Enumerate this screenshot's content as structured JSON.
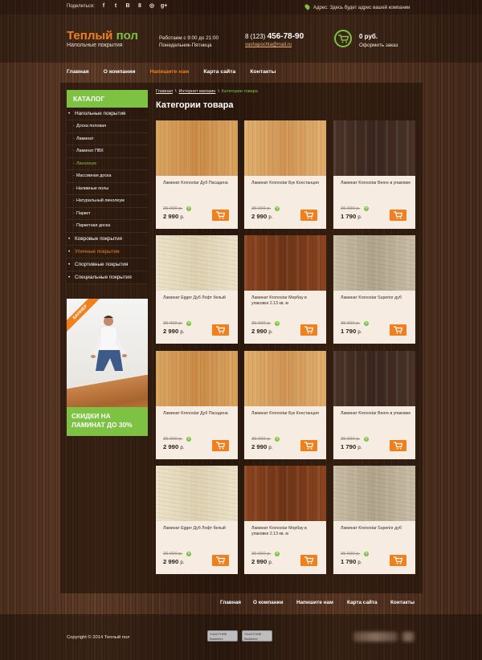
{
  "topbar": {
    "share_label": "Поделиться:",
    "social_icons": [
      "facebook-icon",
      "twitter-icon",
      "vkontakte-icon",
      "odnoklassniki-icon",
      "mailru-icon",
      "googleplus-icon"
    ],
    "social_glyphs": [
      "f",
      "t",
      "B",
      "8",
      "◎",
      "g+"
    ],
    "address": "Адрес: Здесь будет адрес вашей компании"
  },
  "header": {
    "logo_word1": "Теплый",
    "logo_word2": "пол",
    "tagline": "Напольные покрытия",
    "hours_line1": "Работаем с 9:00 до 21:00",
    "hours_line2": "Понедельник-Пятница",
    "phone_code": "8 (123)",
    "phone_number": "456-78-90",
    "email": "vashapochta@mail.ru",
    "cart_sum": "0 руб.",
    "cart_link": "Оформить заказ"
  },
  "nav": {
    "items": [
      {
        "label": "Главная",
        "active": false
      },
      {
        "label": "О компании",
        "active": false
      },
      {
        "label": "Напишите нам",
        "active": true
      },
      {
        "label": "Карта сайта",
        "active": false
      },
      {
        "label": "Контакты",
        "active": false
      }
    ]
  },
  "sidebar": {
    "title": "КАТАЛОГ",
    "items": [
      {
        "label": "Напольные покрытия",
        "level": "top",
        "state": ""
      },
      {
        "label": "Доска половая",
        "level": "sub",
        "state": ""
      },
      {
        "label": "Ламинат",
        "level": "sub",
        "state": ""
      },
      {
        "label": "Ламинат ПВХ",
        "level": "sub",
        "state": ""
      },
      {
        "label": "Линолеум",
        "level": "sub",
        "state": "green"
      },
      {
        "label": "Массивная доска",
        "level": "sub",
        "state": ""
      },
      {
        "label": "Наливные полы",
        "level": "sub",
        "state": ""
      },
      {
        "label": "Натуральный линолеум",
        "level": "sub",
        "state": ""
      },
      {
        "label": "Паркет",
        "level": "sub",
        "state": ""
      },
      {
        "label": "Паркетная доска",
        "level": "sub",
        "state": ""
      },
      {
        "label": "Ковровые покрытия",
        "level": "top",
        "state": ""
      },
      {
        "label": "Уличные покрытия",
        "level": "top",
        "state": "orange"
      },
      {
        "label": "Спортивные покрытия",
        "level": "top",
        "state": ""
      },
      {
        "label": "Специальные покрытия",
        "level": "top",
        "state": ""
      }
    ],
    "banner_ribbon": "БАННЕР",
    "banner_line1": "СКИДКИ НА",
    "banner_line2": "ЛАМИНАТ ДО 30%"
  },
  "breadcrumb": {
    "items": [
      "Главная",
      "Интернет магазин",
      "Категории товара"
    ],
    "separator": "\\"
  },
  "page_title": "Категории товара",
  "products": [
    {
      "name": "Ламинат Kronostar Дуб Пасадена",
      "old_price": "35 990 р.",
      "price": "2 990",
      "unit": "р.",
      "wood": "oak"
    },
    {
      "name": "Ламинат Kronostar Бук Констанция",
      "old_price": "35 990 р.",
      "price": "2 990",
      "unit": "р.",
      "wood": "beech"
    },
    {
      "name": "Ламинат Kronostar Венге в упаковке",
      "old_price": "35 990 р.",
      "price": "1 790",
      "unit": "р.",
      "wood": "wenge"
    },
    {
      "name": "Ламинат Egger Дуб Лофт белый",
      "old_price": "35 990 р.",
      "price": "2 990",
      "unit": "р.",
      "wood": "white"
    },
    {
      "name": "Ламинат Kronostar Мербау в упаковке 2.13 кв. м",
      "old_price": "35 990 р.",
      "price": "2 990",
      "unit": "р.",
      "wood": "merbau"
    },
    {
      "name": "Ламинат Kronostar Superior дуб",
      "old_price": "35 990 р.",
      "price": "1 790",
      "unit": "р.",
      "wood": "grey"
    },
    {
      "name": "Ламинат Kronostar Дуб Пасадена",
      "old_price": "35 990 р.",
      "price": "2 990",
      "unit": "р.",
      "wood": "oak"
    },
    {
      "name": "Ламинат Kronostar Бук Констанция",
      "old_price": "35 990 р.",
      "price": "2 990",
      "unit": "р.",
      "wood": "beech"
    },
    {
      "name": "Ламинат Kronostar Венге в упаковке",
      "old_price": "35 990 р.",
      "price": "1 790",
      "unit": "р.",
      "wood": "wenge"
    },
    {
      "name": "Ламинат Egger Дуб Лофт белый",
      "old_price": "35 990 р.",
      "price": "2 990",
      "unit": "р.",
      "wood": "white"
    },
    {
      "name": "Ламинат Kronostar Мербау в упаковке 2.13 кв. м",
      "old_price": "35 990 р.",
      "price": "2 990",
      "unit": "р.",
      "wood": "merbau"
    },
    {
      "name": "Ламинат Kronostar Superior дуб",
      "old_price": "35 990 р.",
      "price": "1 790",
      "unit": "р.",
      "wood": "grey"
    }
  ],
  "wood_colors": {
    "oak": [
      "#d9a35e",
      "#c98a45"
    ],
    "beech": [
      "#e0ae6c",
      "#cf9352"
    ],
    "wenge": [
      "#4a3328",
      "#3a251c"
    ],
    "white": [
      "#ece2c8",
      "#ddd0b0"
    ],
    "merbau": [
      "#8a4420",
      "#6e3316"
    ],
    "grey": [
      "#c9bca4",
      "#b0a38a"
    ]
  },
  "footer_nav": {
    "items": [
      {
        "label": "Главная",
        "active": false
      },
      {
        "label": "О компании",
        "active": false
      },
      {
        "label": "Напишите нам",
        "active": true
      },
      {
        "label": "Карта сайта",
        "active": false
      },
      {
        "label": "Контакты",
        "active": false
      }
    ]
  },
  "footer": {
    "copyright": "Copyright © 2014 Теплый пол",
    "badge1": "УЧАСТНИК Baubleirz",
    "badge2": "УЧАСТНИК Baubleirz"
  },
  "colors": {
    "accent_orange": "#f07f1e",
    "accent_green": "#7dc242"
  }
}
